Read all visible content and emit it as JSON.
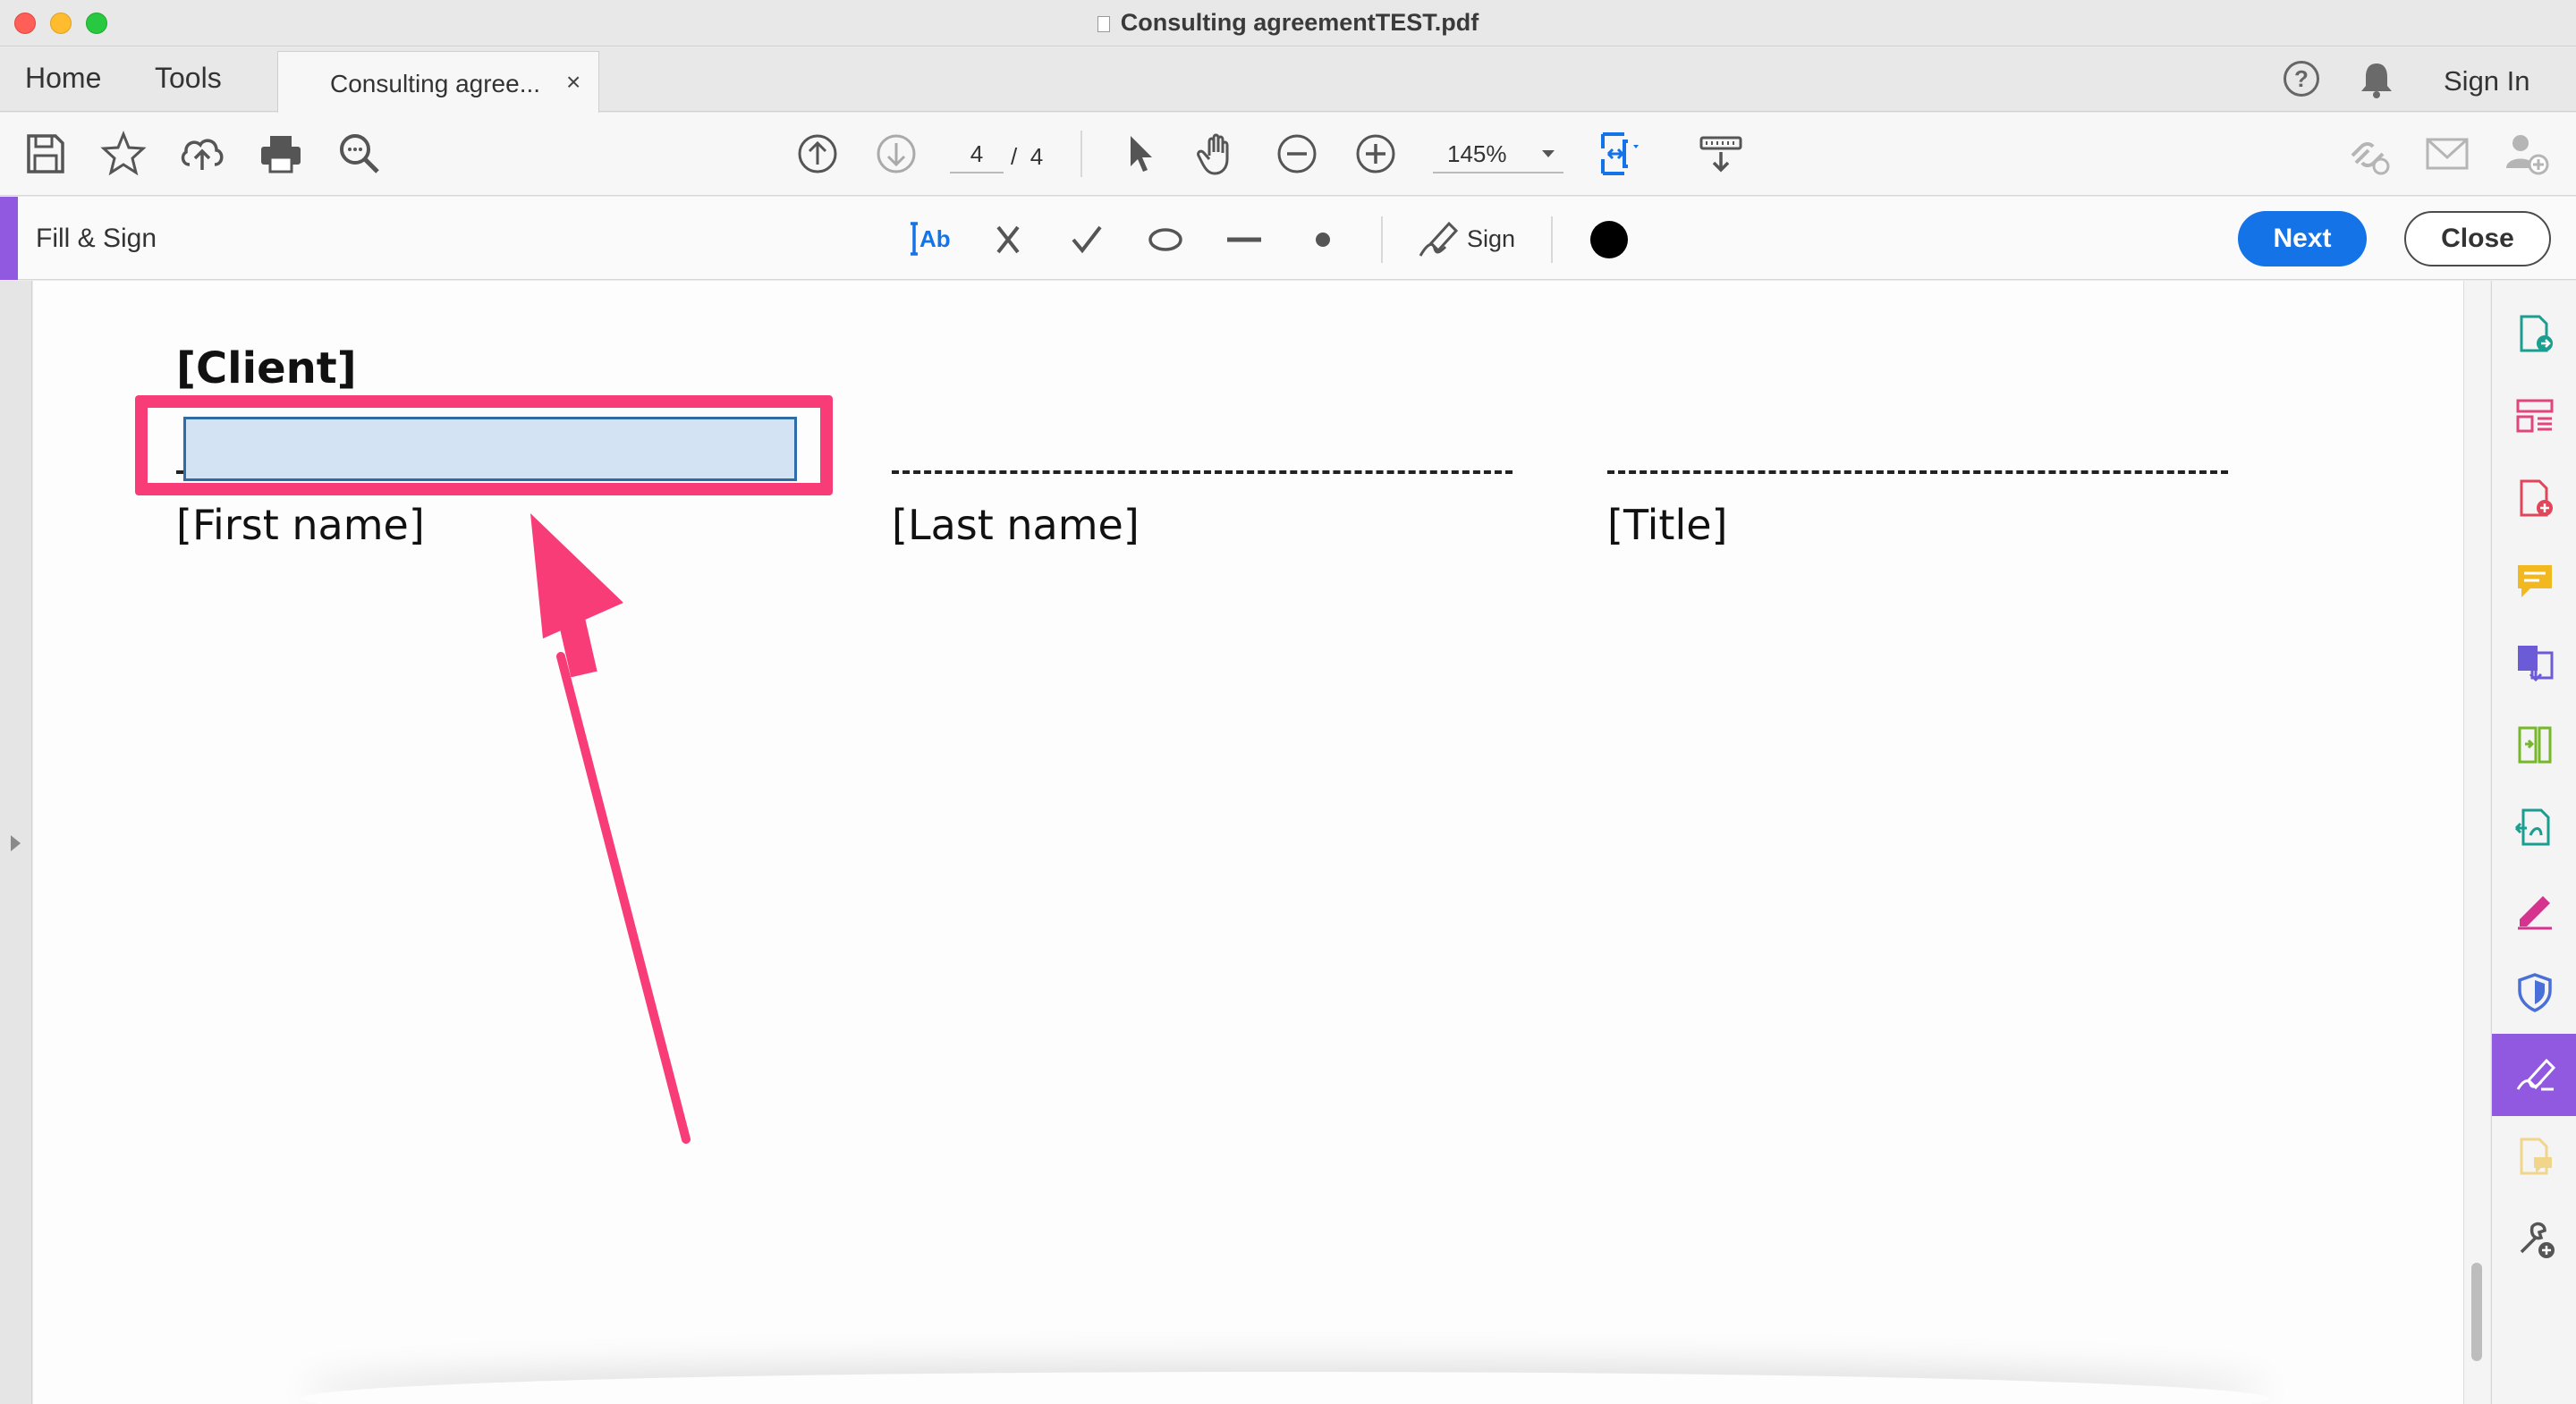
{
  "window": {
    "title": "Consulting agreementTEST.pdf"
  },
  "tabs": {
    "home": "Home",
    "tools": "Tools",
    "document_tab": "Consulting agree...",
    "close_glyph": "×",
    "help_glyph": "?",
    "sign_in": "Sign In"
  },
  "toolbar": {
    "current_page": "4",
    "page_separator": "/",
    "total_pages": "4",
    "zoom": "145%"
  },
  "fill_sign": {
    "title": "Fill & Sign",
    "sign_label": "Sign",
    "next": "Next",
    "close": "Close",
    "ink_color": "#000000"
  },
  "document": {
    "client_label": "[Client]",
    "first_name_label": "[First name]",
    "last_name_label": "[Last name]",
    "title_label": "[Title]"
  },
  "colors": {
    "accent_purple": "#9159e0",
    "primary_blue": "#1473e6",
    "highlight_pink": "#f73c77",
    "field_fill": "#d4e3f3"
  },
  "rail_icons": [
    "export-pdf-icon",
    "organize-pages-icon",
    "create-pdf-icon",
    "comment-icon",
    "combine-files-icon",
    "compress-icon",
    "edit-pdf-icon",
    "fill-sign-icon",
    "protect-icon",
    "request-signatures-icon",
    "send-comments-icon",
    "more-tools-icon"
  ]
}
